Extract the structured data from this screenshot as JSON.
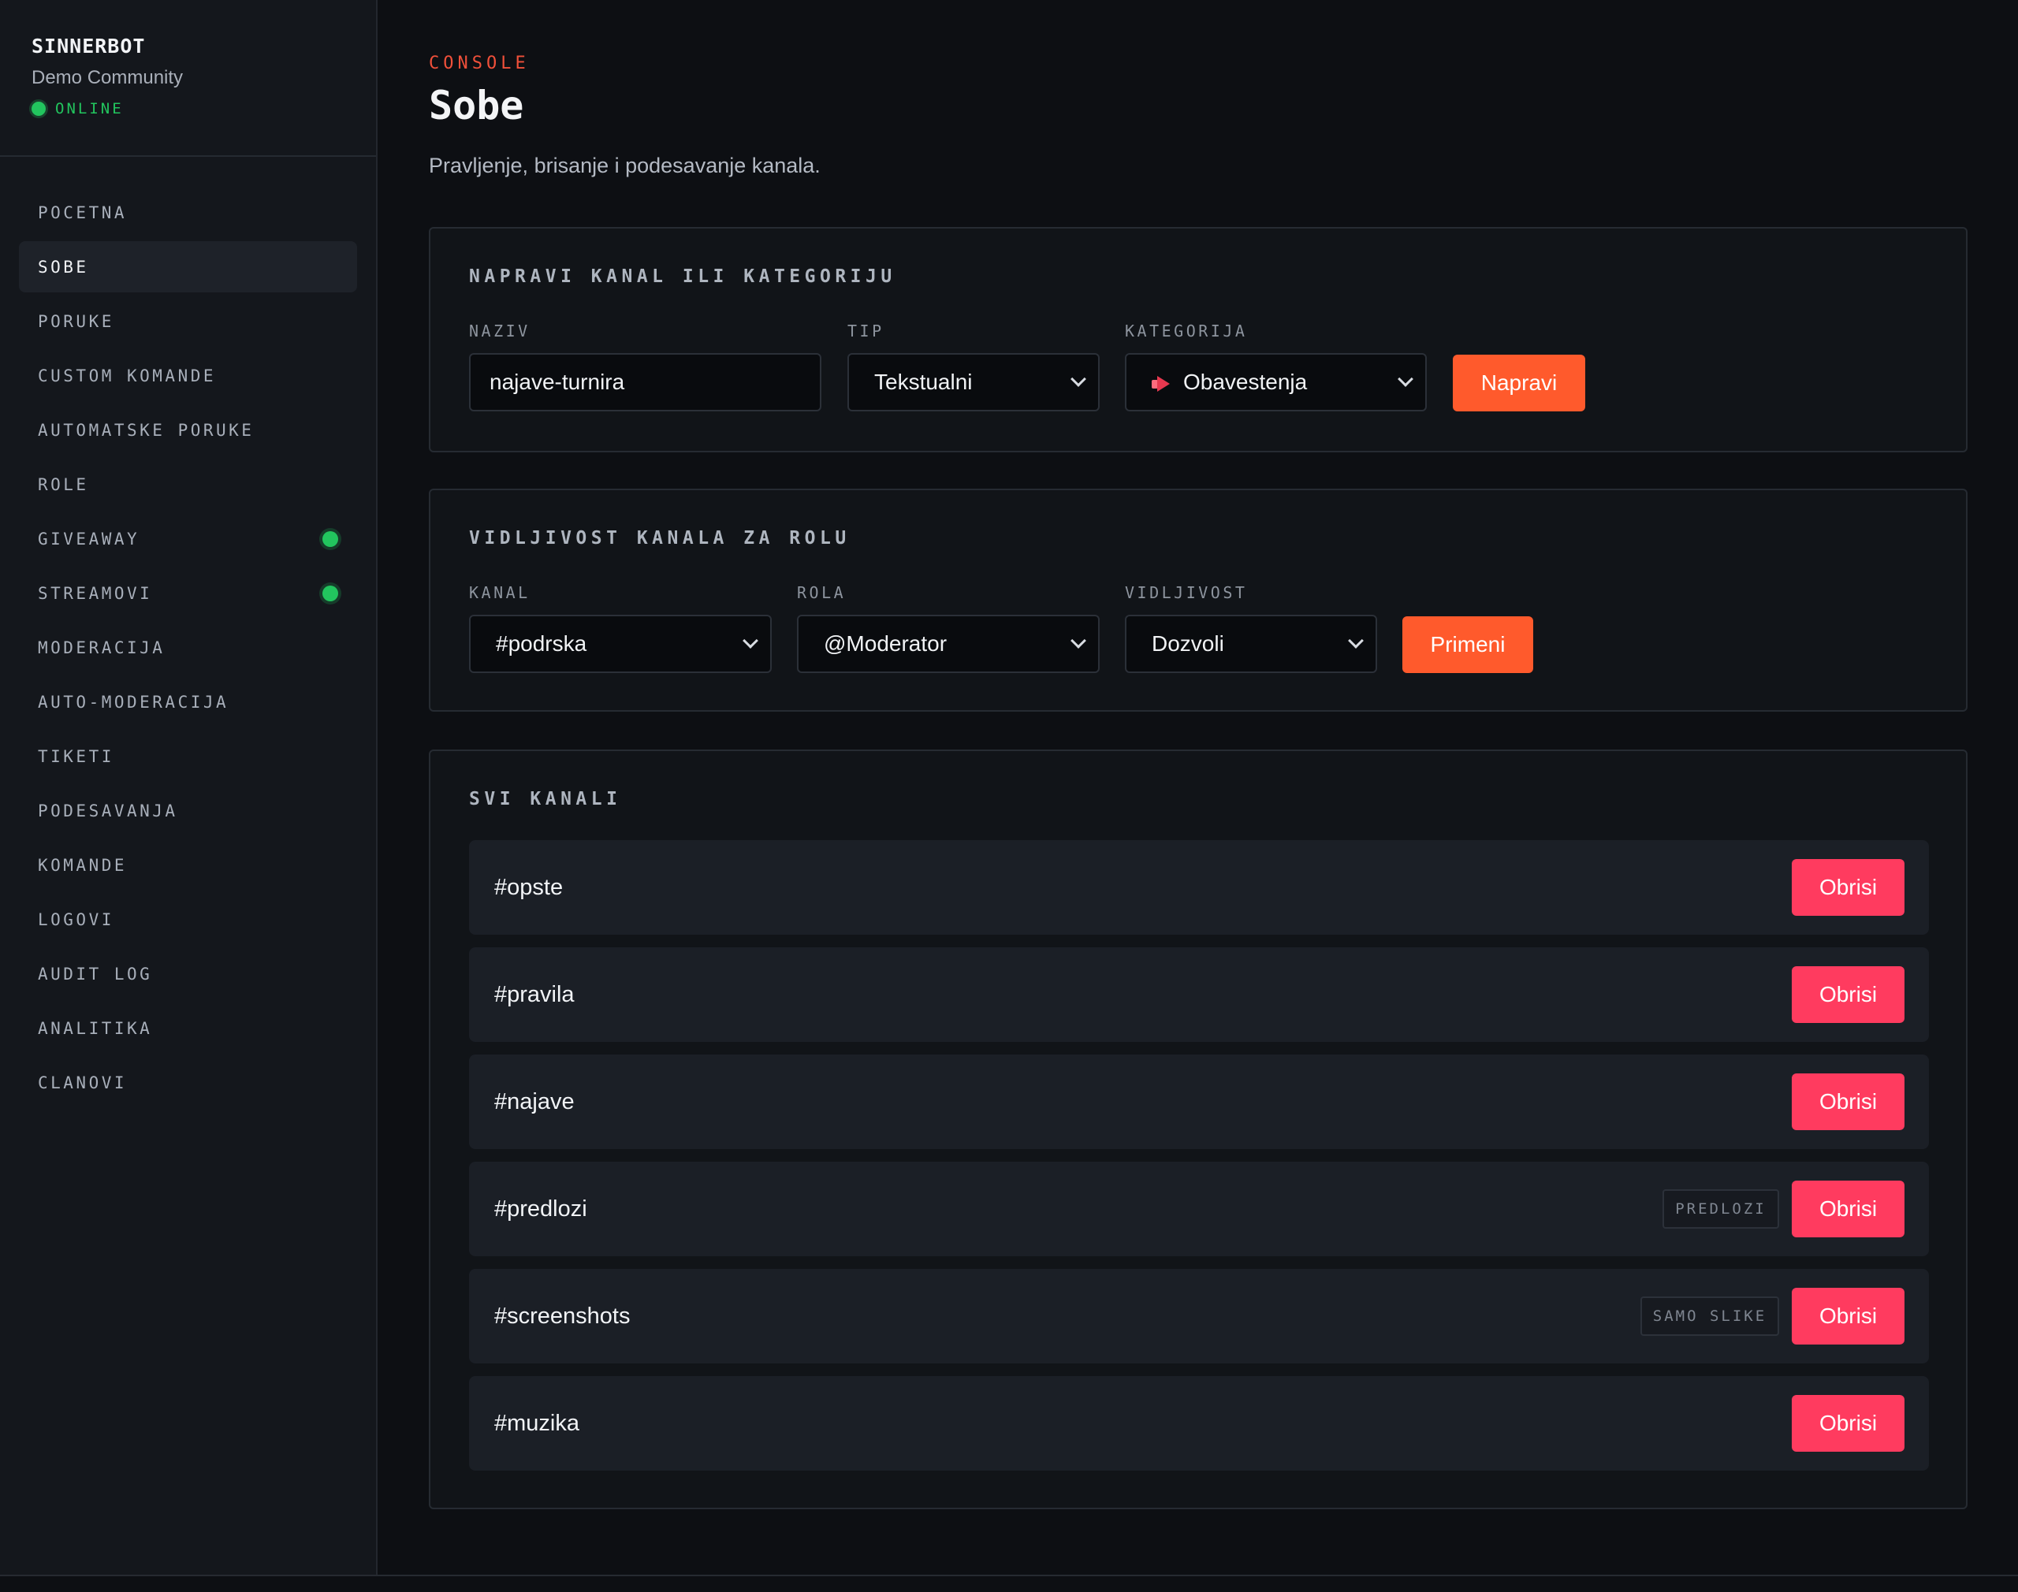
{
  "brand": {
    "name": "SINNERBOT",
    "community": "Demo Community",
    "status": "ONLINE",
    "status_color": "#22c55e"
  },
  "sidebar": {
    "items": [
      {
        "label": "POCETNA",
        "active": false,
        "dot": false
      },
      {
        "label": "SOBE",
        "active": true,
        "dot": false
      },
      {
        "label": "PORUKE",
        "active": false,
        "dot": false
      },
      {
        "label": "CUSTOM KOMANDE",
        "active": false,
        "dot": false
      },
      {
        "label": "AUTOMATSKE PORUKE",
        "active": false,
        "dot": false
      },
      {
        "label": "ROLE",
        "active": false,
        "dot": false
      },
      {
        "label": "GIVEAWAY",
        "active": false,
        "dot": true
      },
      {
        "label": "STREAMOVI",
        "active": false,
        "dot": true
      },
      {
        "label": "MODERACIJA",
        "active": false,
        "dot": false
      },
      {
        "label": "AUTO-MODERACIJA",
        "active": false,
        "dot": false
      },
      {
        "label": "TIKETI",
        "active": false,
        "dot": false
      },
      {
        "label": "PODESAVANJA",
        "active": false,
        "dot": false
      },
      {
        "label": "KOMANDE",
        "active": false,
        "dot": false
      },
      {
        "label": "LOGOVI",
        "active": false,
        "dot": false
      },
      {
        "label": "AUDIT LOG",
        "active": false,
        "dot": false
      },
      {
        "label": "ANALITIKA",
        "active": false,
        "dot": false
      },
      {
        "label": "CLANOVI",
        "active": false,
        "dot": false
      }
    ]
  },
  "header": {
    "eyebrow": "CONSOLE",
    "title": "Sobe",
    "subtitle": "Pravljenje, brisanje i podesavanje kanala."
  },
  "create_card": {
    "title": "NAPRAVI KANAL ILI KATEGORIJU",
    "name_label": "NAZIV",
    "name_value": "najave-turnira",
    "type_label": "TIP",
    "type_value": "Tekstualni",
    "category_label": "KATEGORIJA",
    "category_icon": "megaphone-icon",
    "category_value": "Obavestenja",
    "submit_label": "Napravi"
  },
  "visibility_card": {
    "title": "VIDLJIVOST KANALA ZA ROLU",
    "channel_label": "KANAL",
    "channel_value": "#podrska",
    "role_label": "ROLA",
    "role_value": "@Moderator",
    "visibility_label": "VIDLJIVOST",
    "visibility_value": "Dozvoli",
    "apply_label": "Primeni"
  },
  "channels_card": {
    "title": "SVI KANALI",
    "delete_label": "Obrisi",
    "channels": [
      {
        "name": "#opste",
        "tag": ""
      },
      {
        "name": "#pravila",
        "tag": ""
      },
      {
        "name": "#najave",
        "tag": ""
      },
      {
        "name": "#predlozi",
        "tag": "PREDLOZI"
      },
      {
        "name": "#screenshots",
        "tag": "SAMO SLIKE"
      },
      {
        "name": "#muzika",
        "tag": ""
      }
    ]
  },
  "colors": {
    "accent": "#ff5a2c",
    "danger": "#ff3b5f",
    "eyebrow": "#f0503a",
    "online": "#22c55e"
  }
}
